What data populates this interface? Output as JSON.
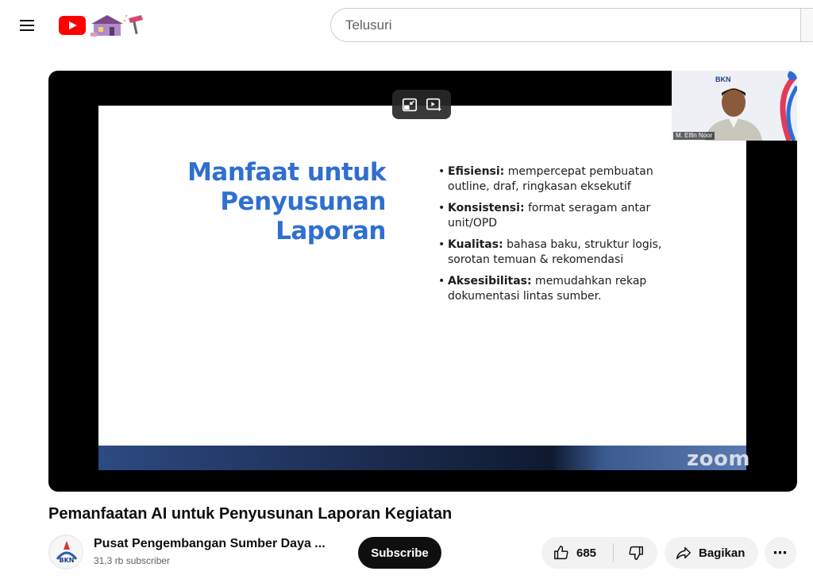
{
  "header": {
    "menu_icon": "hamburger-menu-icon",
    "logo_icon": "youtube-logo-icon",
    "search": {
      "placeholder": "Telusuri",
      "value": ""
    }
  },
  "player": {
    "slide": {
      "title": "Manfaat untuk Penyusunan Laporan",
      "bullets": [
        {
          "term": "Efisiensi:",
          "text": " mempercepat pembuatan outline, draf, ringkasan eksekutif"
        },
        {
          "term": "Konsistensi:",
          "text": " format seragam antar unit/OPD"
        },
        {
          "term": "Kualitas:",
          "text": " bahasa baku, struktur logis, sorotan temuan & rekomendasi"
        },
        {
          "term": "Aksesibilitas:",
          "text": " memudahkan rekap dokumentasi lintas sumber."
        }
      ],
      "watermark": "zoom"
    },
    "webcam": {
      "name_tag": "M. Elfin Noor",
      "brand": "BKN"
    },
    "controls": {
      "exit_pip_icon": "exit-miniplayer-icon",
      "autoplay_icon": "play-sparkle-icon"
    }
  },
  "video": {
    "title": "Pemanfaatan AI untuk Penyusunan Laporan Kegiatan"
  },
  "channel": {
    "name": "Pusat Pengembangan Sumber Daya ...",
    "subscribers": "31,3 rb subscriber",
    "avatar_text": "BKN",
    "subscribe_label": "Subscribe"
  },
  "actions": {
    "like_count": "685",
    "share_label": "Bagikan",
    "more_label": "⋯"
  }
}
